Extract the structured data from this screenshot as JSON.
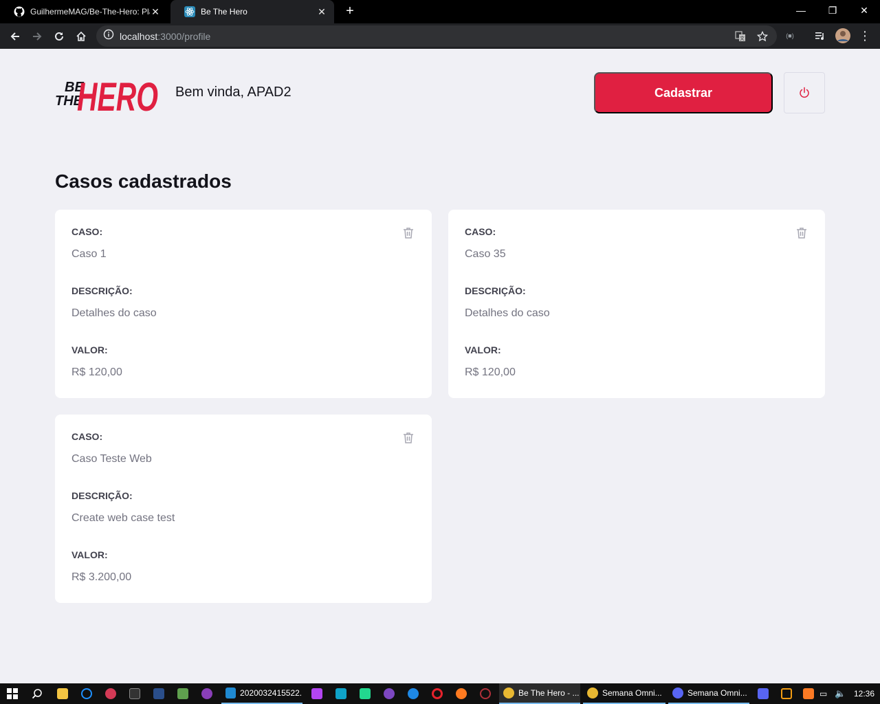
{
  "browser": {
    "tabs": [
      {
        "title": "GuilhermeMAG/Be-The-Hero: Pla",
        "icon": "github-icon"
      },
      {
        "title": "Be The Hero",
        "icon": "react-icon"
      }
    ],
    "url_host": "localhost",
    "url_path": ":3000/profile"
  },
  "header": {
    "logo_top": "BE",
    "logo_mid": "THE",
    "logo_word": "HERO",
    "welcome": "Bem vinda, APAD2",
    "new_button": "Cadastrar",
    "logout_icon": "power-icon"
  },
  "main": {
    "title": "Casos cadastrados",
    "labels": {
      "case": "CASO:",
      "description": "DESCRIÇÃO:",
      "value": "VALOR:"
    },
    "incidents": [
      {
        "title": "Caso 1",
        "description": "Detalhes do caso",
        "value": "R$ 120,00"
      },
      {
        "title": "Caso 35",
        "description": "Detalhes do caso",
        "value": "R$ 120,00"
      },
      {
        "title": "Caso Teste Web",
        "description": "Create web case test",
        "value": "R$ 3.200,00"
      }
    ]
  },
  "colors": {
    "brand": "#e02041",
    "background": "#f0f0f5"
  },
  "taskbar": {
    "apps": [
      {
        "title": "2020032415522..."
      },
      {
        "title": "Be The Hero - ..."
      },
      {
        "title": "Semana Omni..."
      },
      {
        "title": "Semana Omni..."
      }
    ],
    "clock": "12:36"
  }
}
